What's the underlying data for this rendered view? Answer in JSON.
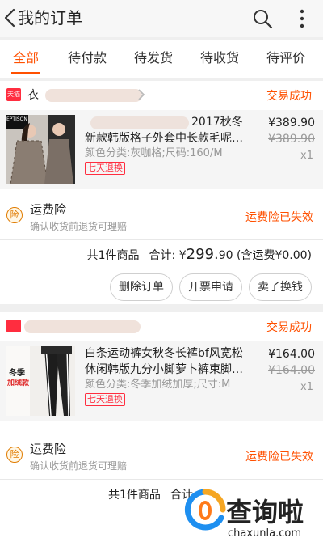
{
  "header": {
    "title": "我的订单",
    "back_icon": "chevron-left-icon",
    "search_icon": "search-icon",
    "more_icon": "more-vertical-icon"
  },
  "tabs": [
    {
      "label": "全部",
      "active": true
    },
    {
      "label": "待付款"
    },
    {
      "label": "待发货"
    },
    {
      "label": "待收货"
    },
    {
      "label": "待评价"
    }
  ],
  "accent_color": "#ff5000",
  "orders": [
    {
      "shop_icon_text": "天猫",
      "shop_name": "衣",
      "status": "交易成功",
      "product": {
        "title_line1": "2017秋冬",
        "title_line2": "新款韩版格子外套中长款毛呢…",
        "spec": "颜色分类:灰咖格;尺码:160/M",
        "badge": "七天退换",
        "price": "¥389.90",
        "original_price": "¥389.90",
        "qty": "x1",
        "thumb_label": "EPTISON"
      },
      "insurance": {
        "title": "运费险",
        "subtitle": "确认收货前退货可理赔",
        "status": "运费险已失效",
        "icon_text": "险"
      },
      "summary": {
        "count": "共1件商品",
        "total_label": "合计:",
        "currency": "¥",
        "total_int": "299.",
        "total_dec": "90",
        "shipping_note": "(含运费¥0.00)"
      },
      "buttons": [
        "删除订单",
        "开票申请",
        "卖了换钱"
      ]
    },
    {
      "shop_icon_text": "",
      "shop_name": "",
      "status": "交易成功",
      "product": {
        "title_line1": "白条运动裤女秋冬长裤bf风宽松",
        "title_line2": "休闲韩版九分小脚萝卜裤束脚…",
        "spec": "颜色分类:冬季加绒加厚;尺寸:M",
        "badge": "七天退换",
        "price": "¥164.00",
        "original_price": "¥164.00",
        "qty": "x1",
        "thumb_label_1": "冬季",
        "thumb_label_2": "加绒款"
      },
      "insurance": {
        "title": "运费险",
        "subtitle": "确认收货前退货可理赔",
        "status": "运费险已失效",
        "icon_text": "险"
      },
      "summary": {
        "count": "共1件商品",
        "total_label": "合计"
      }
    }
  ],
  "watermark": {
    "text": "查询啦",
    "url": "chaxunla.com"
  }
}
